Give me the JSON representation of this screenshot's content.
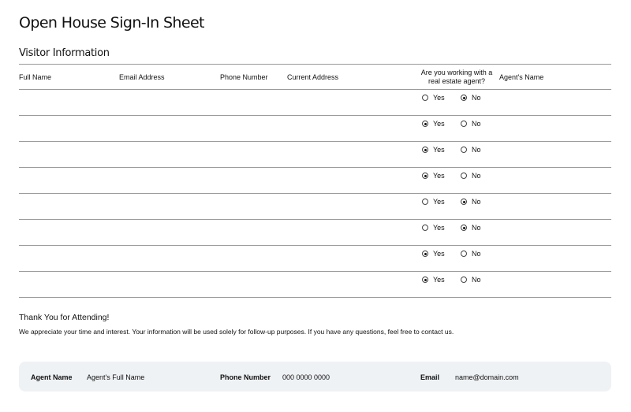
{
  "title": "Open House Sign-In Sheet",
  "section": "Visitor Information",
  "columns": [
    "Full Name",
    "Email Address",
    "Phone Number",
    "Current Address",
    "Are you working with a real estate agent?",
    "Agent's Name"
  ],
  "options": {
    "yes": "Yes",
    "no": "No"
  },
  "rows": [
    {
      "working_with_agent": "No"
    },
    {
      "working_with_agent": "Yes"
    },
    {
      "working_with_agent": "Yes"
    },
    {
      "working_with_agent": "Yes"
    },
    {
      "working_with_agent": "No"
    },
    {
      "working_with_agent": "No"
    },
    {
      "working_with_agent": "Yes"
    },
    {
      "working_with_agent": "Yes"
    }
  ],
  "thanks": {
    "heading": "Thank You for Attending!",
    "text": "We appreciate your time and interest. Your information will be used solely for follow-up purposes. If you have any questions, feel free to contact us."
  },
  "footer": {
    "agent_label": "Agent Name",
    "agent_value": "Agent's Full Name",
    "phone_label": "Phone Number",
    "phone_value": "000 0000 0000",
    "email_label": "Email",
    "email_value": "name@domain.com"
  }
}
